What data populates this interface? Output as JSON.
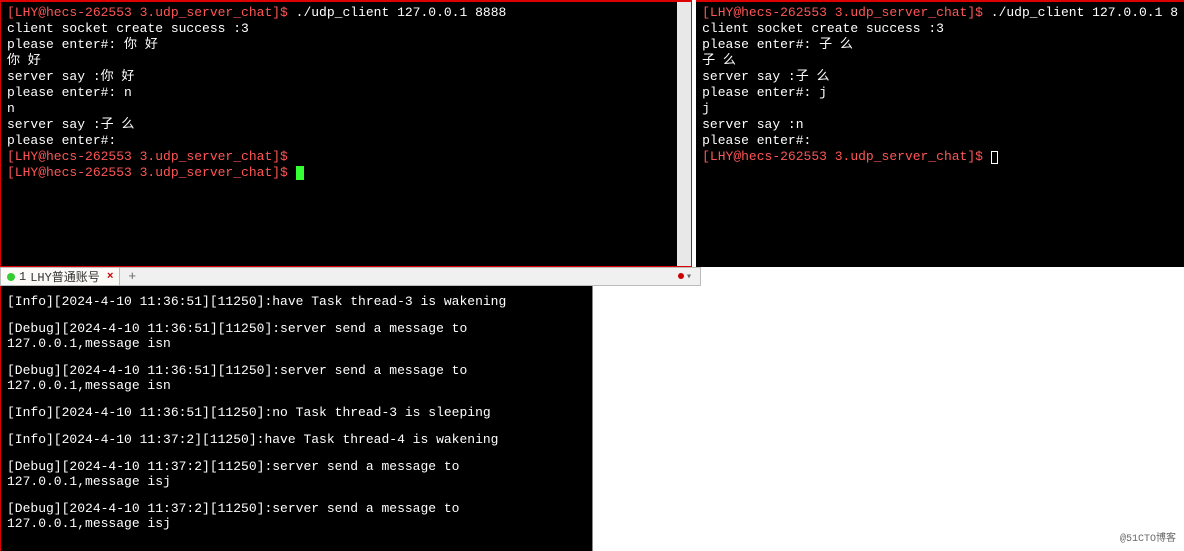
{
  "left_terminal": {
    "lines": [
      {
        "prompt": "[LHY@hecs-262553 3.udp_server_chat]$ ",
        "cmd": "./udp_client 127.0.0.1 8888"
      },
      {
        "text": "client socket create success :3"
      },
      {
        "text": "please enter#: 你 好"
      },
      {
        "text": "你 好"
      },
      {
        "text": "server say :你 好"
      },
      {
        "text": "please enter#: n"
      },
      {
        "text": "n"
      },
      {
        "text": "server say :子 么"
      },
      {
        "text": "please enter#:"
      },
      {
        "text": ""
      },
      {
        "prompt": "[LHY@hecs-262553 3.udp_server_chat]$",
        "cmd": ""
      },
      {
        "prompt": "[LHY@hecs-262553 3.udp_server_chat]$ ",
        "cursor": "block"
      }
    ]
  },
  "right_terminal": {
    "lines": [
      {
        "prompt": "[LHY@hecs-262553 3.udp_server_chat]$ ",
        "cmd": "./udp_client 127.0.0.1 8"
      },
      {
        "text": "client socket create success :3"
      },
      {
        "text": "please enter#: 子 么"
      },
      {
        "text": "子 么"
      },
      {
        "text": "server say :子 么"
      },
      {
        "text": "please enter#: j"
      },
      {
        "text": "j"
      },
      {
        "text": "server say :n"
      },
      {
        "text": "please enter#:"
      },
      {
        "text": ""
      },
      {
        "prompt": "[LHY@hecs-262553 3.udp_server_chat]$ ",
        "cursor": "outline"
      }
    ]
  },
  "tab_bar": {
    "tab_number": "1",
    "tab_label": "LHY普通账号",
    "close_glyph": "×",
    "add_glyph": "+",
    "collapse_glyph": "▾"
  },
  "bottom_terminal": {
    "logs": [
      "[Info][2024-4-10 11:36:51][11250]:have Task thread-3 is wakening",
      "[Debug][2024-4-10 11:36:51][11250]:server send a message to 127.0.0.1,message isn",
      "[Debug][2024-4-10 11:36:51][11250]:server send a message to 127.0.0.1,message isn",
      "[Info][2024-4-10 11:36:51][11250]:no Task thread-3 is sleeping",
      "[Info][2024-4-10 11:37:2][11250]:have Task thread-4 is wakening",
      "[Debug][2024-4-10 11:37:2][11250]:server send a message to 127.0.0.1,message isj",
      "[Debug][2024-4-10 11:37:2][11250]:server send a message to 127.0.0.1,message isj"
    ]
  },
  "watermark": "@51CTO博客"
}
